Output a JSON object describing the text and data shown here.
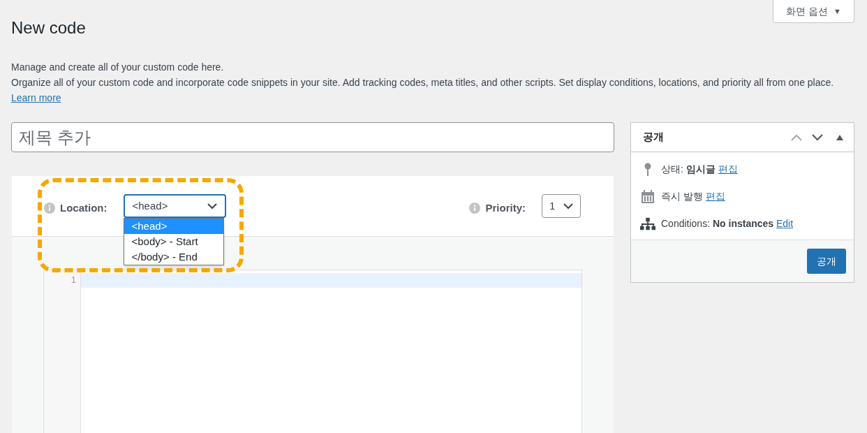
{
  "screen_options": {
    "label": "화면 옵션",
    "caret": "▼"
  },
  "heading": "New code",
  "description": [
    "Manage and create all of your custom code here.",
    "Organize all of your custom code and incorporate code snippets in your site. Add tracking codes, meta titles, and other scripts. Set display conditions, locations, and priority all from one place."
  ],
  "learn_more": "Learn more",
  "title_field": {
    "placeholder": "제목 추가"
  },
  "location": {
    "label": "Location:",
    "value": "<head>",
    "expanded": true,
    "options": [
      {
        "label": "<head>",
        "selected": true
      },
      {
        "label": "<body> - Start",
        "selected": false
      },
      {
        "label": "</body> - End",
        "selected": false
      }
    ]
  },
  "priority": {
    "label": "Priority:",
    "value": "1"
  },
  "editor": {
    "line_numbers": [
      "1"
    ]
  },
  "publish_box": {
    "title": "공개",
    "rows": [
      {
        "kind": "pin",
        "text": "상태: **임시글**",
        "link": "편집"
      },
      {
        "kind": "calendar",
        "text": "즉시 발행",
        "link": "편집"
      },
      {
        "kind": "sitemap",
        "text": "Conditions: **No instances**",
        "link": "Edit"
      }
    ],
    "button": "공개"
  }
}
